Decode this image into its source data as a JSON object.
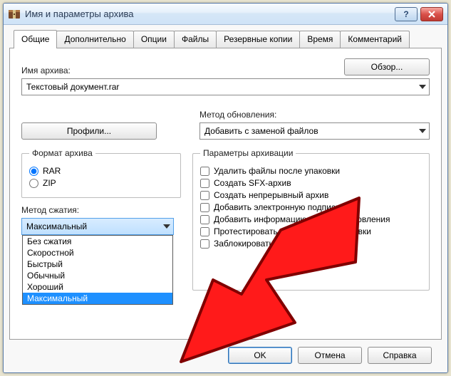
{
  "window": {
    "title": "Имя и параметры архива"
  },
  "tabs": [
    "Общие",
    "Дополнительно",
    "Опции",
    "Файлы",
    "Резервные копии",
    "Время",
    "Комментарий"
  ],
  "archive": {
    "name_label": "Имя архива:",
    "name_value": "Текстовый документ.rar",
    "browse_label": "Обзор..."
  },
  "profiles_btn": "Профили...",
  "update": {
    "label": "Метод обновления:",
    "value": "Добавить с заменой файлов"
  },
  "format": {
    "legend": "Формат архива",
    "rar": "RAR",
    "zip": "ZIP"
  },
  "compression": {
    "label": "Метод сжатия:",
    "value": "Максимальный",
    "options": [
      "Без сжатия",
      "Скоростной",
      "Быстрый",
      "Обычный",
      "Хороший",
      "Максимальный"
    ]
  },
  "params": {
    "legend": "Параметры архивации",
    "opts": [
      "Удалить файлы после упаковки",
      "Создать SFX-архив",
      "Создать непрерывный архив",
      "Добавить электронную подпись",
      "Добавить информацию для восстановления",
      "Протестировать файлы после упаковки",
      "Заблокировать архив"
    ]
  },
  "buttons": {
    "ok": "OK",
    "cancel": "Отмена",
    "help": "Справка"
  }
}
